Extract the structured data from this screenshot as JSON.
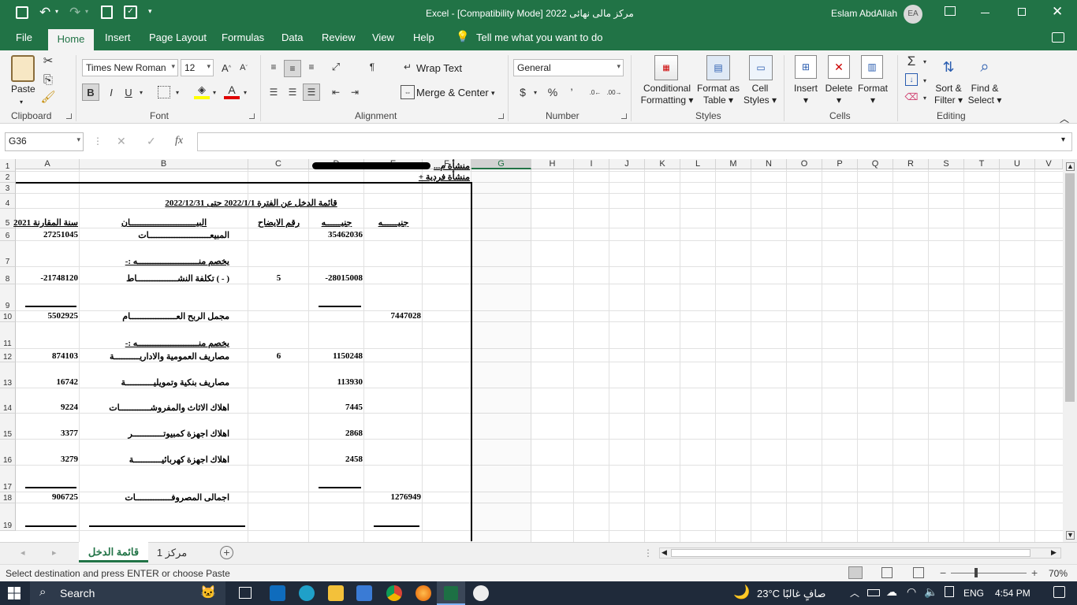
{
  "window": {
    "title": "مركز مالى نهائى 2022  [Compatibility Mode]  -  Excel",
    "user": "Eslam AbdAllah",
    "initials": "EA"
  },
  "menu": {
    "file": "File",
    "home": "Home",
    "insert": "Insert",
    "page_layout": "Page Layout",
    "formulas": "Formulas",
    "data": "Data",
    "review": "Review",
    "view": "View",
    "help": "Help",
    "tell": "Tell me what you want to do"
  },
  "ribbon": {
    "paste": "Paste",
    "clipboard": "Clipboard",
    "font_name": "Times New Roman",
    "font_size": "12",
    "font": "Font",
    "bold": "B",
    "italic": "I",
    "underline": "U",
    "wrap_text": "Wrap Text",
    "merge_center": "Merge & Center",
    "alignment": "Alignment",
    "number_format": "General",
    "number": "Number",
    "currency": "$",
    "percent": "%",
    "comma": "’",
    "conditional": "Conditional",
    "formatting": "Formatting",
    "format_as": "Format as",
    "table": "Table",
    "cell": "Cell",
    "styles_lbl": "Styles",
    "styles": "Styles",
    "insert": "Insert",
    "delete": "Delete",
    "format": "Format",
    "cells": "Cells",
    "sort_filter_1": "Sort &",
    "sort_filter_2": "Filter",
    "find_select_1": "Find &",
    "find_select_2": "Select",
    "editing": "Editing",
    "sigma": "Σ"
  },
  "formula": {
    "name_box": "G36",
    "fx": "fx",
    "value": ""
  },
  "columns": [
    "A",
    "B",
    "C",
    "D",
    "E",
    "F",
    "G",
    "H",
    "I",
    "J",
    "K",
    "L",
    "M",
    "N",
    "O",
    "P",
    "Q",
    "R",
    "S",
    "T",
    "U",
    "V"
  ],
  "rows": [
    "1",
    "2",
    "3",
    "4",
    "5",
    "6",
    "7",
    "8",
    "9",
    "10",
    "11",
    "12",
    "13",
    "14",
    "15",
    "16",
    "17",
    "18",
    "19"
  ],
  "sheet": {
    "r1": "منشأة م...",
    "r2": "منشأة فردية +",
    "title": "قائمة الدخل عن الفترة  2022/1/1 حتى 2022/12/31",
    "h_a": "سنة المقارنة 2021",
    "h_b": "البيــــــــــــــــــــــــــان",
    "h_c": "رقم الايضاح",
    "h_d": "جنيــــــه",
    "h_e": "جنيــــــه",
    "sales_lbl": "المبيعــــــــــــــــــــــــات",
    "sales_a": "27251045",
    "sales_d": "35462036",
    "deduct1": "يخصم منــــــــــــــــــــــــه :-",
    "cogs_lbl": "( - ) تكلفة النشــــــــــــــــاط",
    "cogs_c": "5",
    "cogs_a": "-21748120",
    "cogs_d": "-28015008",
    "gp_lbl": "مجمل الربح العــــــــــــــــــام",
    "gp_a": "5502925",
    "gp_e": "7447028",
    "deduct2": "يخصم منــــــــــــــــــــــــه :-",
    "admin_lbl": "مصاريف العمومية والاداريــــــــــة",
    "admin_c": "6",
    "admin_a": "874103",
    "admin_d": "1150248",
    "bank_lbl": "مصاريف بنكية وتمويليـــــــــــة",
    "bank_a": "16742",
    "bank_d": "113930",
    "furn_lbl": "اهلاك الاثاث والمفروشــــــــــــات",
    "furn_a": "9224",
    "furn_d": "7445",
    "comp_lbl": "اهلاك اجهزة كمبيوتــــــــــــر",
    "comp_a": "3377",
    "comp_d": "2868",
    "elec_lbl": "اهلاك اجهزة كهربائيـــــــــــة",
    "elec_a": "3279",
    "elec_d": "2458",
    "total_lbl": "اجمالى المصروفــــــــــــــات",
    "total_a": "906725",
    "total_e": "1276949"
  },
  "tabs": {
    "active": "قائمة الدخل",
    "other": "مركز 1"
  },
  "status": {
    "message": "Select destination and press ENTER or choose Paste",
    "zoom": "70%"
  },
  "taskbar": {
    "search": "Search",
    "weather": "23°C  صافٍ غالبًا",
    "lang": "ENG",
    "time": "4:54 PM"
  },
  "colors": {
    "accent": "#217346",
    "taskbar": "#1f2a3a"
  }
}
